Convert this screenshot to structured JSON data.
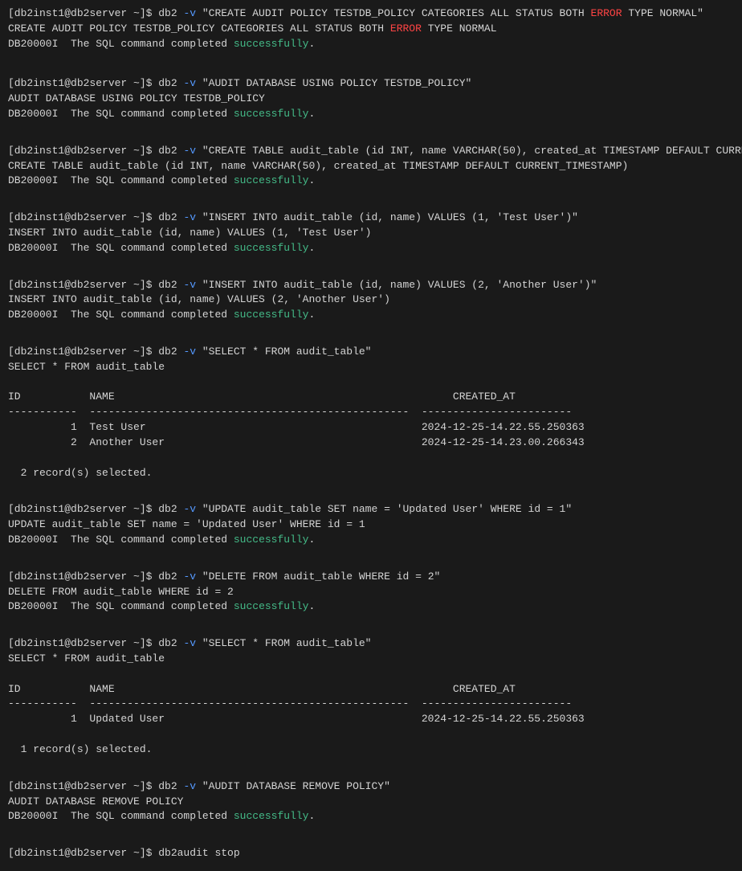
{
  "terminal": {
    "bg": "#1a1a1a",
    "fg": "#d4d4d4",
    "success_color": "#44bb88",
    "error_color": "#ff4444",
    "flag_color": "#5599ff"
  },
  "blocks": [
    {
      "id": "block1",
      "prompt": "[db2inst1@db2server ~]$ db2 ",
      "flag": "-v",
      "command": " \"CREATE AUDIT POLICY TESTDB_POLICY CATEGORIES ALL STATUS BOTH ",
      "error_word": "ERROR",
      "command2": " TYPE NORMAL\"",
      "output_lines": [
        "CREATE AUDIT POLICY TESTDB_POLICY CATEGORIES ALL STATUS BOTH ",
        " TYPE NORMAL",
        "DB20000I  The SQL command completed "
      ],
      "has_error_in_output": true,
      "success_label": "successfully",
      "dot": "."
    },
    {
      "id": "block2",
      "prompt": "[db2inst1@db2server ~]$ db2 ",
      "flag": "-v",
      "command": " \"AUDIT DATABASE USING POLICY TESTDB_POLICY\"",
      "output_lines": [
        "AUDIT DATABASE USING POLICY TESTDB_POLICY",
        "DB20000I  The SQL command completed "
      ],
      "success_label": "successfully",
      "dot": "."
    },
    {
      "id": "block3",
      "prompt": "[db2inst1@db2server ~]$ db2 ",
      "flag": "-v",
      "command": " \"CREATE TABLE audit_table (id INT, name VARCHAR(50), created_at TIMESTAMP DEFAULT CURRENT_TIMESTAMP)\"",
      "output_lines": [
        "CREATE TABLE audit_table (id INT, name VARCHAR(50), created_at TIMESTAMP DEFAULT CURRENT_TIMESTAMP)",
        "DB20000I  The SQL command completed "
      ],
      "success_label": "successfully",
      "dot": "."
    },
    {
      "id": "block4",
      "prompt": "[db2inst1@db2server ~]$ db2 ",
      "flag": "-v",
      "command": " \"INSERT INTO audit_table (id, name) VALUES (1, 'Test User')\"",
      "output_lines": [
        "INSERT INTO audit_table (id, name) VALUES (1, 'Test User')",
        "DB20000I  The SQL command completed "
      ],
      "success_label": "successfully",
      "dot": "."
    },
    {
      "id": "block5",
      "prompt": "[db2inst1@db2server ~]$ db2 ",
      "flag": "-v",
      "command": " \"INSERT INTO audit_table (id, name) VALUES (2, 'Another User')\"",
      "output_lines": [
        "INSERT INTO audit_table (id, name) VALUES (2, 'Another User')",
        "DB20000I  The SQL command completed "
      ],
      "success_label": "successfully",
      "dot": "."
    },
    {
      "id": "block6",
      "prompt": "[db2inst1@db2server ~]$ db2 ",
      "flag": "-v",
      "command": " \"SELECT * FROM audit_table\"",
      "output_lines": [
        "SELECT * FROM audit_table",
        ""
      ],
      "table": {
        "headers": [
          "ID",
          "NAME",
          "CREATED_AT"
        ],
        "sep1": "-----------",
        "sep2": "---------------------------------------------------",
        "sep3": "------------------------",
        "rows": [
          [
            "1",
            "Test User",
            "2024-12-25-14.22.55.250363"
          ],
          [
            "2",
            "Another User",
            "2024-12-25-14.23.00.266343"
          ]
        ],
        "summary": "  2 record(s) selected."
      }
    },
    {
      "id": "block7",
      "prompt": "[db2inst1@db2server ~]$ db2 ",
      "flag": "-v",
      "command": " \"UPDATE audit_table SET name = 'Updated User' WHERE id = 1\"",
      "output_lines": [
        "UPDATE audit_table SET name = 'Updated User' WHERE id = 1",
        "DB20000I  The SQL command completed "
      ],
      "success_label": "successfully",
      "dot": "."
    },
    {
      "id": "block8",
      "prompt": "[db2inst1@db2server ~]$ db2 ",
      "flag": "-v",
      "command": " \"DELETE FROM audit_table WHERE id = 2\"",
      "output_lines": [
        "DELETE FROM audit_table WHERE id = 2",
        "DB20000I  The SQL command completed "
      ],
      "success_label": "successfully",
      "dot": "."
    },
    {
      "id": "block9",
      "prompt": "[db2inst1@db2server ~]$ db2 ",
      "flag": "-v",
      "command": " \"SELECT * FROM audit_table\"",
      "output_lines": [
        "SELECT * FROM audit_table",
        ""
      ],
      "table": {
        "headers": [
          "ID",
          "NAME",
          "CREATED_AT"
        ],
        "sep1": "-----------",
        "sep2": "---------------------------------------------------",
        "sep3": "------------------------",
        "rows": [
          [
            "1",
            "Updated User",
            "2024-12-25-14.22.55.250363"
          ]
        ],
        "summary": "  1 record(s) selected."
      }
    },
    {
      "id": "block10",
      "prompt": "[db2inst1@db2server ~]$ db2 ",
      "flag": "-v",
      "command": " \"AUDIT DATABASE REMOVE POLICY\"",
      "output_lines": [
        "AUDIT DATABASE REMOVE POLICY",
        "DB20000I  The SQL command completed "
      ],
      "success_label": "successfully",
      "dot": "."
    },
    {
      "id": "block11",
      "prompt": "[db2inst1@db2server ~]$ db2audit stop",
      "flag": "",
      "command": "",
      "output_lines": []
    }
  ]
}
